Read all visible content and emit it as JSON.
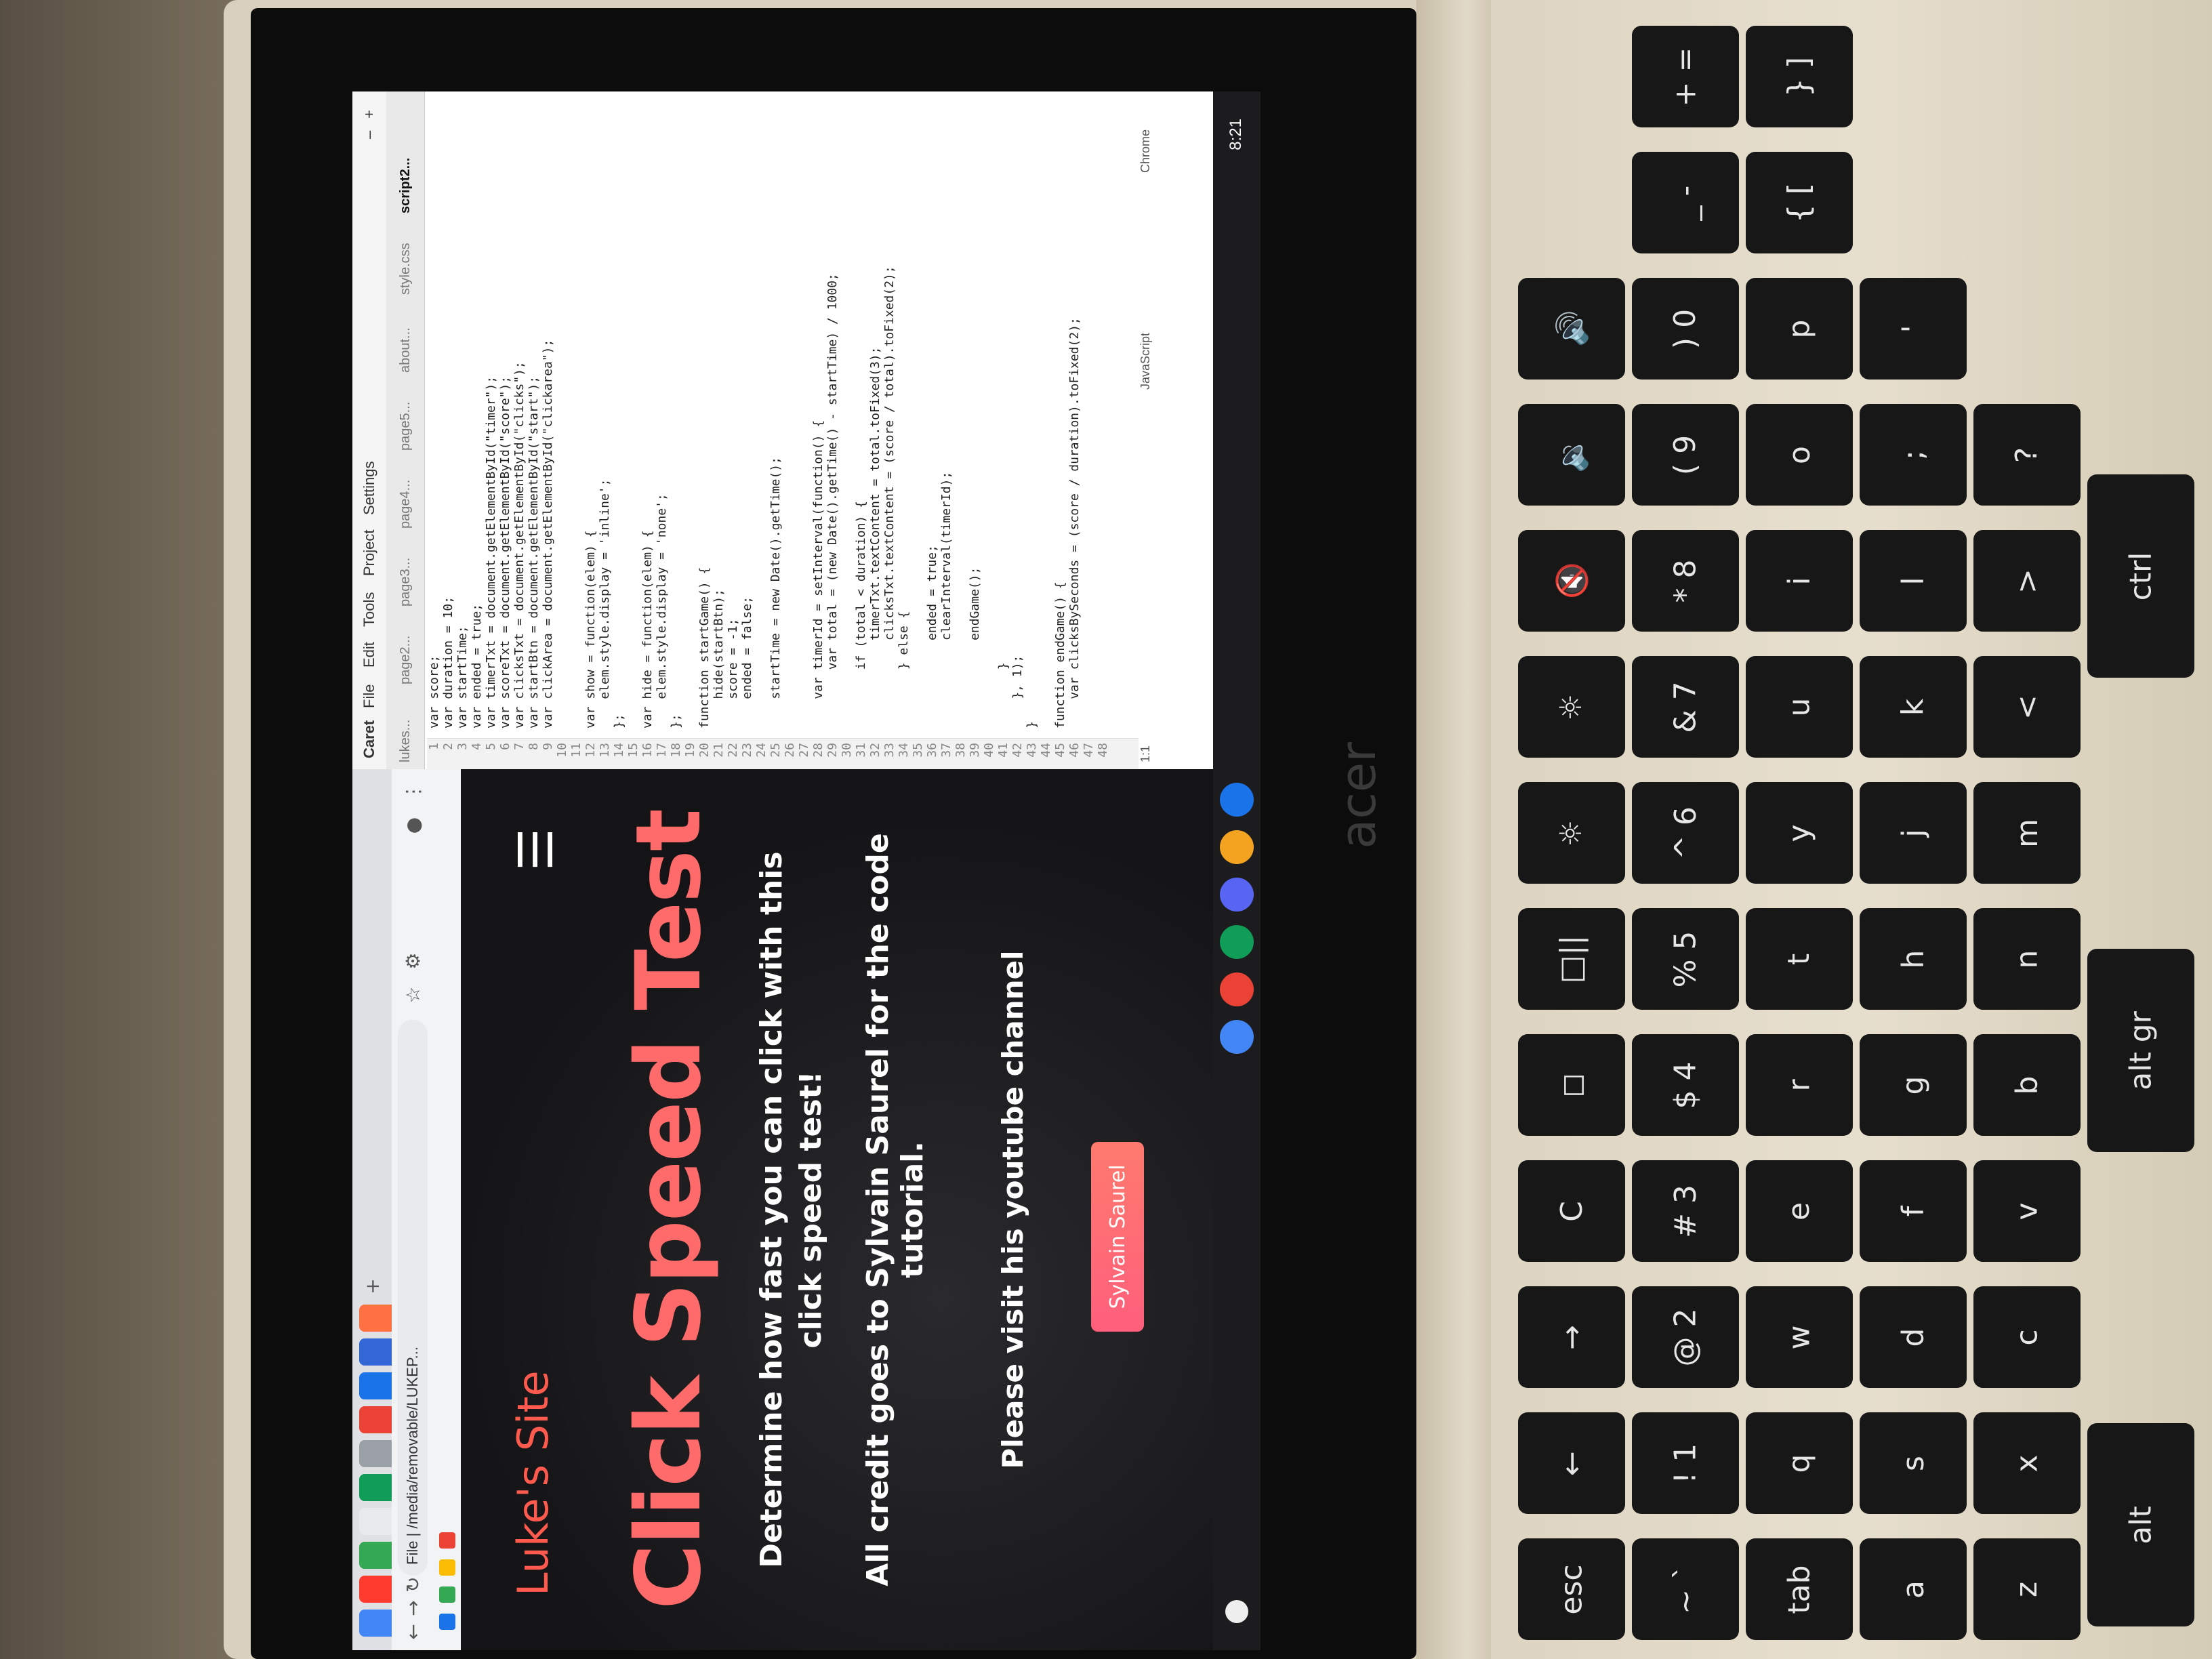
{
  "browser": {
    "address": "File | /media/removable/LUKEP...",
    "site_title": "Luke's Site",
    "headline": "Click Speed Test",
    "description": "Determine how fast you can click with this click speed test!",
    "credit": "All credit goes to Sylvain Saurel for the code tutorial.",
    "visit": "Please visit his youtube channel",
    "button": "Sylvain Saurel"
  },
  "editor": {
    "menu": [
      "Caret",
      "File",
      "Edit",
      "Tools",
      "Project",
      "Settings"
    ],
    "tabs": [
      "lukes...",
      "page2...",
      "page3...",
      "page4...",
      "page5...",
      "about...",
      "style.css",
      "script2..."
    ],
    "code": [
      "var score;",
      "var duration = 10;",
      "var startTime;",
      "var ended = true;",
      "var timerTxt = document.getElementById(\"timer\");",
      "var scoreTxt = document.getElementById(\"score\");",
      "var clicksTxt = document.getElementById(\"clicks\");",
      "var startBtn = document.getElementById(\"start\");",
      "var clickArea = document.getElementById(\"clickarea\");",
      "",
      "",
      "var show = function(elem) {",
      "    elem.style.display = 'inline';",
      "};",
      "",
      "var hide = function(elem) {",
      "    elem.style.display = 'none';",
      "};",
      "",
      "function startGame() {",
      "    hide(startBtn);",
      "    score = -1;",
      "    ended = false;",
      "",
      "    startTime = new Date().getTime();",
      "",
      "",
      "    var timerId = setInterval(function() {",
      "        var total = (new Date().getTime() - startTime) / 1000;",
      "",
      "        if (total < duration) {",
      "            timerTxt.textContent = total.toFixed(3);",
      "            clicksTxt.textContent = (score / total).toFixed(2);",
      "        } else {",
      "",
      "            ended = true;",
      "            clearInterval(timerId);",
      "",
      "            endGame();",
      "",
      "        }",
      "    }, 1);",
      "}",
      "",
      "function endGame() {",
      "    var clicksBySeconds = (score / duration).toFixed(2);"
    ],
    "line_numbers": "1\n2\n3\n4\n5\n6\n7\n8\n9\n10\n11\n12\n13\n14\n15\n16\n17\n18\n19\n20\n21\n22\n23\n24\n25\n26\n27\n28\n29\n30\n31\n32\n33\n34\n35\n36\n37\n38\n39\n40\n41\n42\n43\n44\n45\n46\n47\n48",
    "status_pos": "1:1",
    "status_lang": "JavaScript",
    "status_app": "Chrome"
  },
  "shelf": {
    "time": "8:21"
  },
  "laptop": {
    "brand": "acer"
  },
  "keyboard": {
    "row1": [
      "esc",
      "←",
      "→",
      "C",
      "◻",
      "□||",
      "☼",
      "☼",
      "🔇",
      "🔉",
      "🔊"
    ],
    "row2": [
      "~ `",
      "! 1",
      "@ 2",
      "# 3",
      "$ 4",
      "% 5",
      "^ 6",
      "& 7",
      "* 8",
      "( 9",
      ") 0",
      "_ -",
      "+ ="
    ],
    "row3": [
      "tab",
      "q",
      "w",
      "e",
      "r",
      "t",
      "y",
      "u",
      "i",
      "o",
      "p",
      "{ [",
      "} ]"
    ],
    "row4": [
      "a",
      "s",
      "d",
      "f",
      "g",
      "h",
      "j",
      "k",
      "l",
      ";",
      "'"
    ],
    "row5": [
      "z",
      "x",
      "c",
      "v",
      "b",
      "n",
      "m",
      "<",
      ">",
      "?"
    ],
    "row6": [
      "alt",
      "alt gr",
      "ctrl"
    ]
  },
  "colors": {
    "accent": "#ff5a4e",
    "button": "#ff6f75",
    "page_bg": "#141416"
  }
}
